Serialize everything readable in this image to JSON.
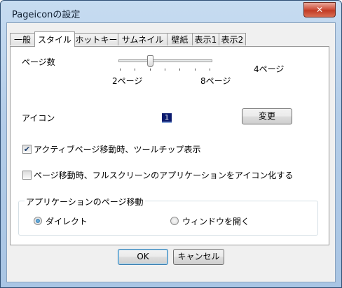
{
  "window": {
    "title": "Pageiconの設定",
    "close_glyph": "✕"
  },
  "tabs": [
    {
      "label": "一般"
    },
    {
      "label": "スタイル",
      "active": true
    },
    {
      "label": "ホットキー"
    },
    {
      "label": "サムネイル"
    },
    {
      "label": "壁紙"
    },
    {
      "label": "表示1"
    },
    {
      "label": "表示2"
    }
  ],
  "page_count": {
    "label": "ページ数",
    "min_label": "2ページ",
    "max_label": "8ページ",
    "current_label": "4ページ",
    "slider_value": 4,
    "slider_min": 2,
    "slider_max": 8
  },
  "icon": {
    "label": "アイコン",
    "preview_text": "1",
    "change_button": "変更"
  },
  "options": {
    "tooltip_checkbox": {
      "label": "アクティブページ移動時、ツールチップ表示",
      "checked": true
    },
    "fullscreen_checkbox": {
      "label": "ページ移動時、フルスクリーンのアプリケーションをアイコン化する",
      "checked": false
    }
  },
  "app_move_group": {
    "title": "アプリケーションのページ移動",
    "direct": {
      "label": "ダイレクト",
      "checked": true
    },
    "open_window": {
      "label": "ウィンドウを開く",
      "checked": false
    }
  },
  "footer": {
    "ok": "OK",
    "cancel": "キャンセル"
  }
}
